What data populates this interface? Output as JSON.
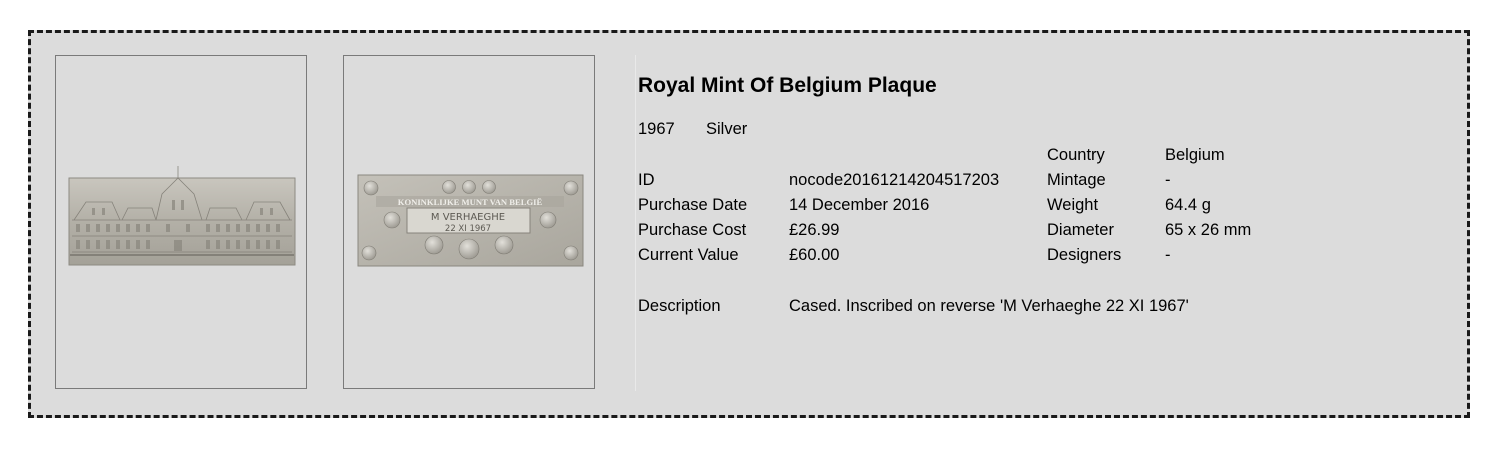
{
  "item": {
    "title": "Royal Mint Of Belgium Plaque",
    "year": "1967",
    "metal": "Silver",
    "obverse_image": "Plaque obverse - building facade",
    "reverse_image": "Plaque reverse",
    "reverse_inscription": {
      "top": "KONINKLIJKE MUNT VAN BELGIË",
      "line1": "M VERHAEGHE",
      "line2": "22 XI 1967"
    }
  },
  "details": {
    "id_label": "ID",
    "id_value": "nocode20161214204517203",
    "purchase_date_label": "Purchase Date",
    "purchase_date_value": "14 December 2016",
    "purchase_cost_label": "Purchase Cost",
    "purchase_cost_value": "£26.99",
    "current_value_label": "Current Value",
    "current_value_value": "£60.00",
    "description_label": "Description",
    "description_value": "Cased.  Inscribed on reverse 'M Verhaeghe 22 XI 1967'"
  },
  "specs": {
    "country_label": "Country",
    "country_value": "Belgium",
    "mintage_label": "Mintage",
    "mintage_value": "-",
    "weight_label": "Weight",
    "weight_value": "64.4 g",
    "diameter_label": "Diameter",
    "diameter_value": "65 x 26 mm",
    "designers_label": "Designers",
    "designers_value": "-"
  },
  "colors": {
    "card_background": "#dcdcdc",
    "border": "#1a1a1a",
    "metal": "#b8b5ac"
  }
}
